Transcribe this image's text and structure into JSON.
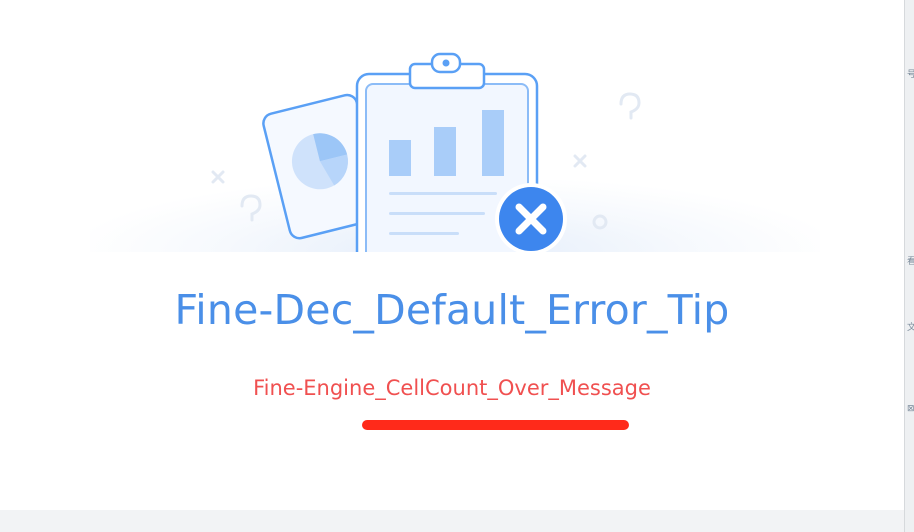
{
  "dialog": {
    "title": "Fine-Dec_Default_Error_Tip",
    "message": "Fine-Engine_CellCount_Over_Message",
    "illustration_icon": "report-clipboard-error-illustration",
    "status_icon": "error-x-icon"
  },
  "colors": {
    "title": "#4a8fe8",
    "message": "#f05050",
    "annotation_underline": "#ff2a1a",
    "error_badge": "#3d86ee",
    "illustration_stroke": "#5aa0f5"
  },
  "gutter": {
    "marks": [
      "号",
      "看",
      "文",
      "⊠"
    ]
  }
}
